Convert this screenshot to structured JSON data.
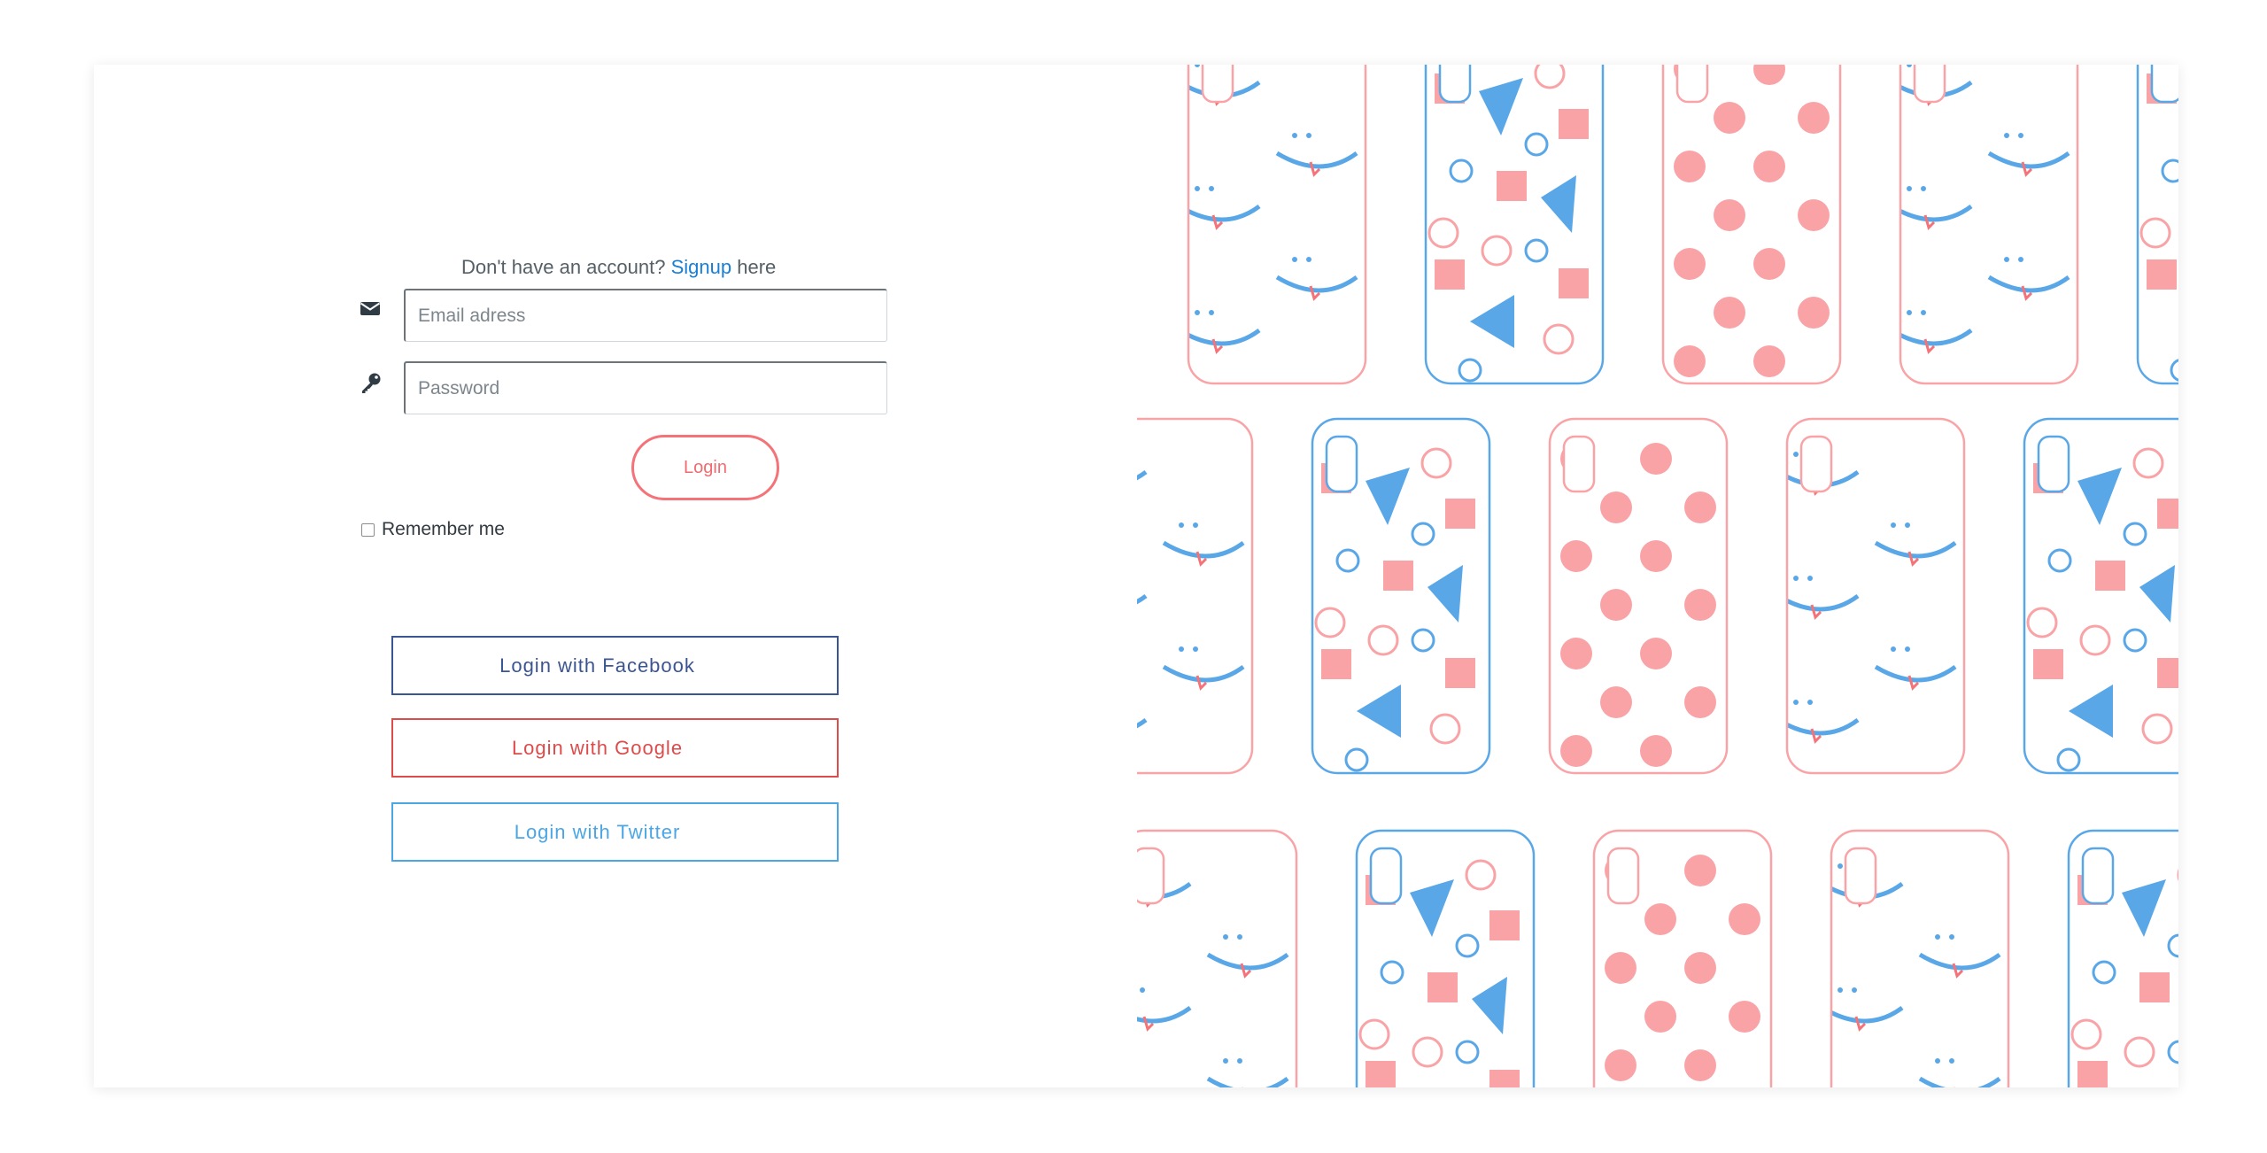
{
  "signup": {
    "prefix": "Don't have an account?",
    "link": "Signup",
    "suffix": "here"
  },
  "email": {
    "placeholder": "Email adress",
    "icon": "envelope-icon"
  },
  "password": {
    "placeholder": "Password",
    "icon": "key-icon"
  },
  "remember": {
    "label": "Remember me",
    "checked": false
  },
  "login_button": {
    "label": "Login"
  },
  "social": {
    "facebook": "Login with Facebook",
    "google": "Login with Google",
    "twitter": "Login with Twitter"
  },
  "colors": {
    "accent_pink": "#f37378",
    "pattern_pink": "#f9a3a7",
    "pattern_blue": "#5aa7e8",
    "facebook": "#3b5592",
    "google": "#dd4b4b",
    "twitter": "#4aa6e5",
    "link": "#1a7fd4"
  },
  "pattern": {
    "description_icon": "phone-case-pattern-image"
  }
}
